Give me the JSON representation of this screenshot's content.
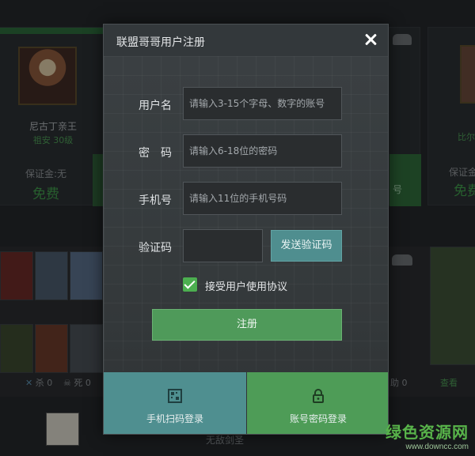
{
  "modal": {
    "title": "联盟哥哥用户注册",
    "fields": {
      "username": {
        "label": "用户名",
        "placeholder": "请输入3-15个字母、数字的账号"
      },
      "password": {
        "label": "密　码",
        "placeholder": "请输入6-18位的密码"
      },
      "phone": {
        "label": "手机号",
        "placeholder": "请输入11位的手机号码"
      },
      "code": {
        "label": "验证码",
        "placeholder": ""
      }
    },
    "send_code_label": "发送验证码",
    "agree": {
      "checked": true,
      "label": "接受用户使用协议"
    },
    "register_label": "注册",
    "tabs": {
      "qr_label": "手机扫码登录",
      "account_label": "账号密码登录"
    }
  },
  "background": {
    "card_left": {
      "name": "尼古丁亲王",
      "sub": "祖安 30级",
      "deposit_label": "保证金:无",
      "deposit_value": "免费"
    },
    "card_right": {
      "name": "比尔",
      "deposit_label": "保证金",
      "deposit_value": "免费"
    },
    "mid_fragment": "号",
    "stats": {
      "kills": "杀 0",
      "deaths": "死 0",
      "assist": "助 0",
      "view": "查看"
    },
    "bottom_fragment": "无敌剑圣"
  },
  "watermark": {
    "brand": "绿色资源网",
    "url": "www.downcc.com"
  },
  "colors": {
    "accent_green": "#4e9c57",
    "accent_teal": "#4f8f90",
    "check_green": "#4caf50"
  }
}
